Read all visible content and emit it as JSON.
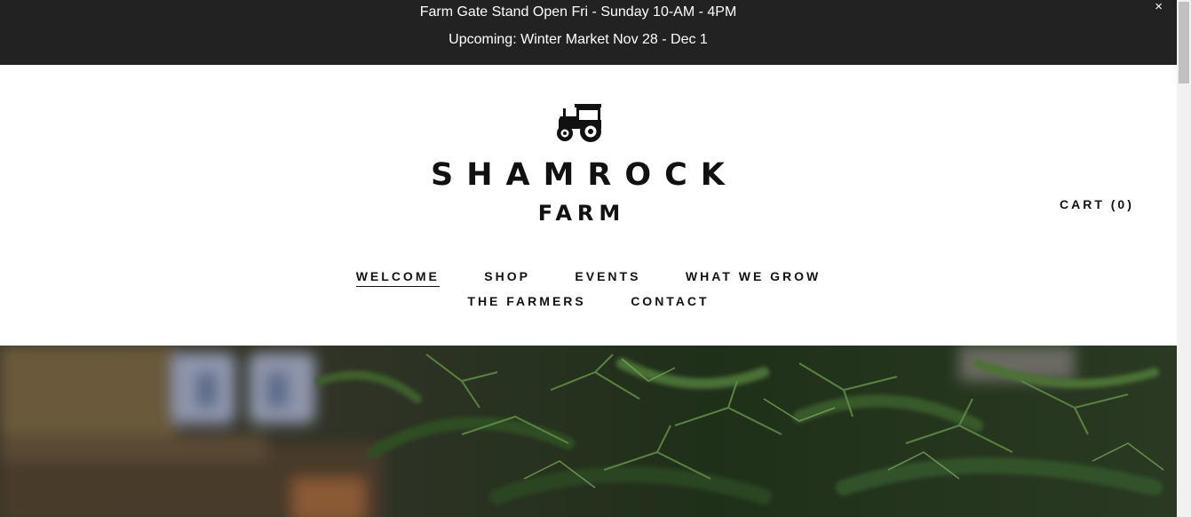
{
  "announcement": {
    "line1": "Farm Gate Stand Open Fri - Sunday 10-AM - 4PM",
    "line2": "Upcoming: Winter Market Nov 28 - Dec 1",
    "close_glyph": "×"
  },
  "logo": {
    "icon": "tractor-icon",
    "line1": "SHAMROCK",
    "line2": "FARM"
  },
  "cart": {
    "label": "CART (0)"
  },
  "nav": {
    "items": [
      {
        "label": "WELCOME",
        "active": true
      },
      {
        "label": "SHOP",
        "active": false
      },
      {
        "label": "EVENTS",
        "active": false
      },
      {
        "label": "WHAT WE GROW",
        "active": false
      },
      {
        "label": "THE FARMERS",
        "active": false
      },
      {
        "label": "CONTACT",
        "active": false
      }
    ]
  },
  "colors": {
    "announcement_bg": "#222222",
    "text": "#111111",
    "hero_green": "#2f4a22"
  }
}
